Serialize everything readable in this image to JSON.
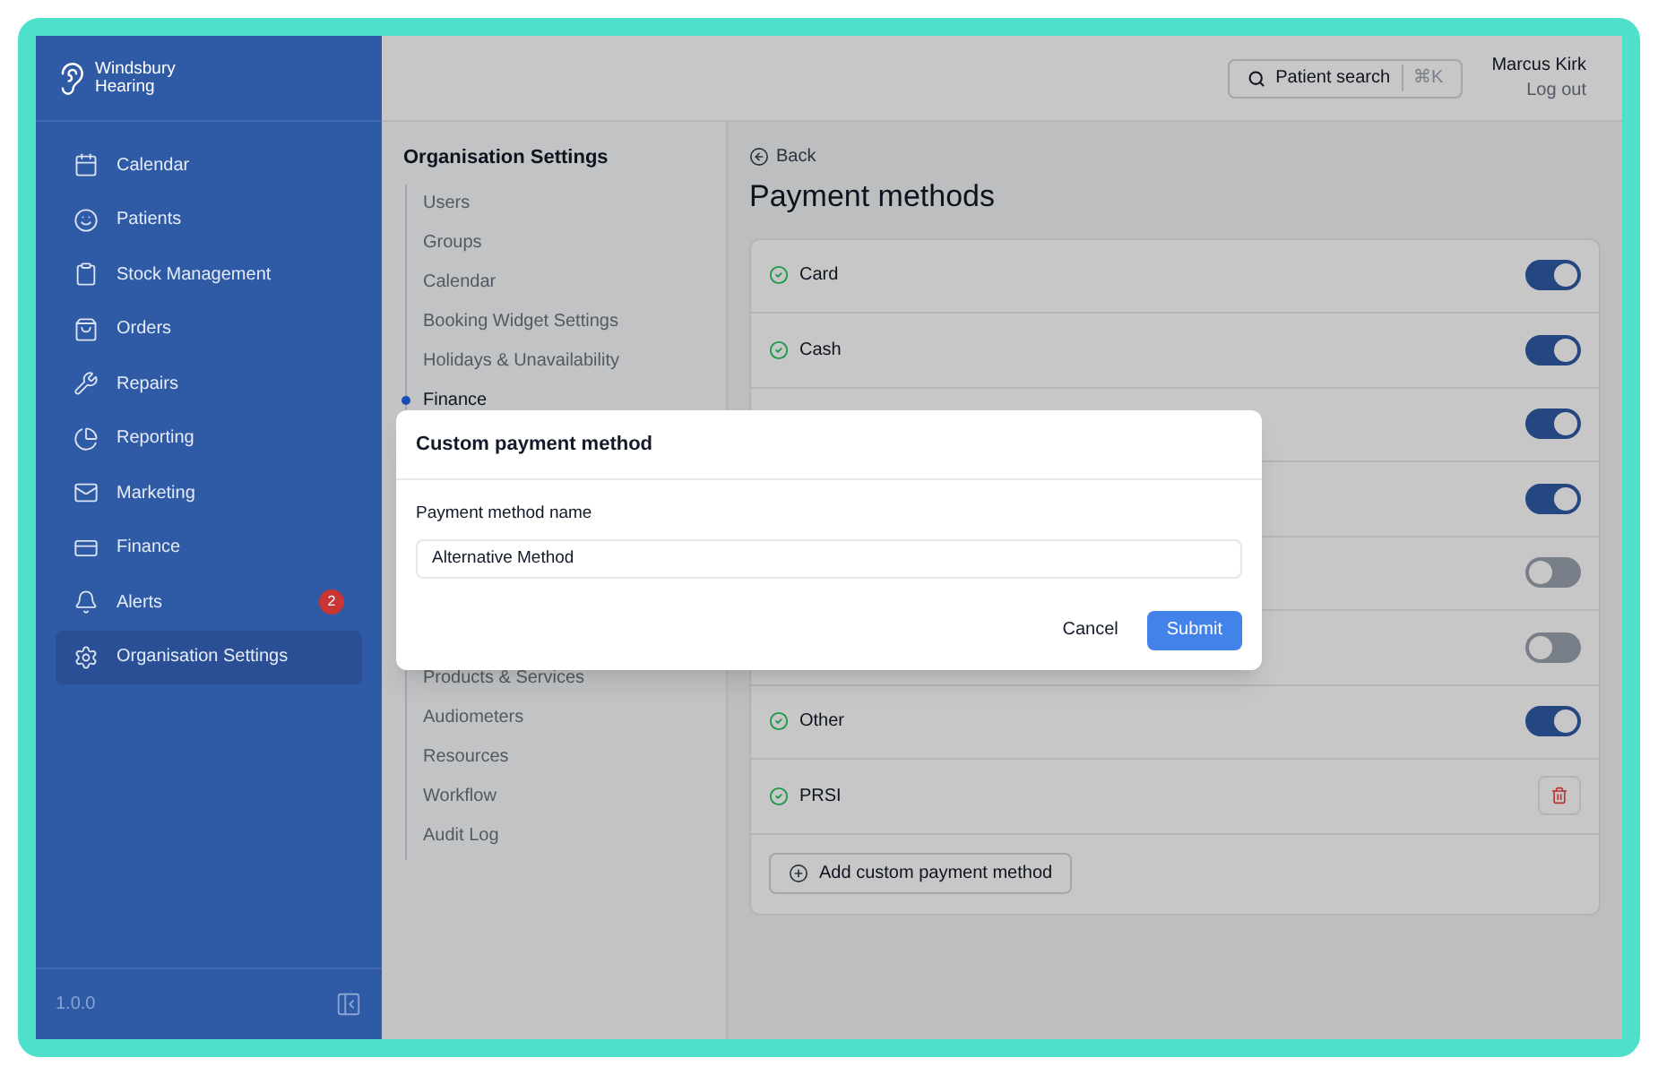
{
  "brand": {
    "line_1": "Windsbury",
    "line_2": "Hearing"
  },
  "nav": [
    {
      "label": "Calendar",
      "selected": false
    },
    {
      "label": "Patients",
      "selected": false
    },
    {
      "label": "Stock Management",
      "selected": false
    },
    {
      "label": "Orders",
      "selected": false
    },
    {
      "label": "Repairs",
      "selected": false
    },
    {
      "label": "Reporting",
      "selected": false
    },
    {
      "label": "Marketing",
      "selected": false
    },
    {
      "label": "Finance",
      "selected": false
    },
    {
      "label": "Alerts",
      "selected": false,
      "badge": "2"
    },
    {
      "label": "Organisation Settings",
      "selected": true
    }
  ],
  "version": "1.0.0",
  "topbar": {
    "search": {
      "label": "Patient search",
      "shortcut": "⌘K"
    },
    "user": {
      "name": "Marcus Kirk",
      "logout": "Log out"
    }
  },
  "settings": {
    "title": "Organisation Settings",
    "items": [
      {
        "label": "Users",
        "selected": false
      },
      {
        "label": "Groups",
        "selected": false
      },
      {
        "label": "Calendar",
        "selected": false
      },
      {
        "label": "Booking Widget Settings",
        "selected": false
      },
      {
        "label": "Holidays & Unavailability",
        "selected": false
      },
      {
        "label": "Finance",
        "selected": true
      }
    ],
    "items_below_dialog": [
      {
        "label": "Products & Services",
        "selected": false
      },
      {
        "label": "Audiometers",
        "selected": false
      },
      {
        "label": "Resources",
        "selected": false
      },
      {
        "label": "Workflow",
        "selected": false
      },
      {
        "label": "Audit Log",
        "selected": false
      }
    ]
  },
  "page": {
    "back": "Back",
    "title": "Payment methods",
    "methods": [
      {
        "label": "Card",
        "kind": "toggle",
        "on": true
      },
      {
        "label": "Cash",
        "kind": "toggle",
        "on": true
      },
      {
        "kind": "toggle",
        "on": true
      },
      {
        "kind": "toggle",
        "on": true
      },
      {
        "kind": "toggle",
        "on": false
      },
      {
        "kind": "toggle",
        "on": false
      },
      {
        "label": "Other",
        "kind": "toggle",
        "on": true
      },
      {
        "label": "PRSI",
        "kind": "deletable"
      }
    ],
    "add_button": "Add custom payment method"
  },
  "dialog": {
    "title": "Custom payment method",
    "field_label": "Payment method name",
    "value": "Alternative Method",
    "cancel": "Cancel",
    "submit": "Submit"
  }
}
